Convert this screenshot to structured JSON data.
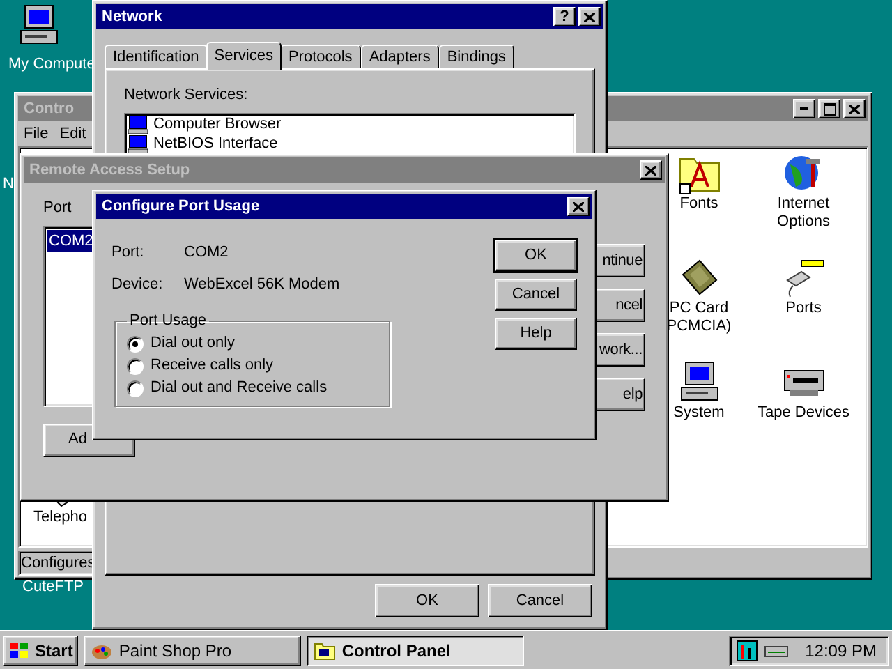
{
  "desktop": {
    "icons": [
      {
        "label": "My Compute"
      },
      {
        "label": "N"
      },
      {
        "label": "CuteFTP"
      }
    ]
  },
  "control_panel": {
    "title": "Contro",
    "active": false,
    "menu": [
      "File",
      "Edit"
    ],
    "items": [
      {
        "lines": [
          "Fonts"
        ]
      },
      {
        "lines": [
          "Internet",
          "Options"
        ]
      },
      {
        "lines": [
          "PC Card",
          "PCMCIA)"
        ]
      },
      {
        "lines": [
          "Ports"
        ]
      },
      {
        "lines": [
          "System"
        ]
      },
      {
        "lines": [
          "Tape Devices"
        ]
      },
      {
        "lines": [
          "Telepho"
        ]
      }
    ],
    "status_bar": "Configures"
  },
  "network": {
    "title": "Network",
    "active": true,
    "help_button": "?",
    "tabs": [
      {
        "label": "Identification",
        "selected": false
      },
      {
        "label": "Services",
        "selected": true
      },
      {
        "label": "Protocols",
        "selected": false
      },
      {
        "label": "Adapters",
        "selected": false
      },
      {
        "label": "Bindings",
        "selected": false
      }
    ],
    "list_label": "Network Services:",
    "services": [
      "Computer Browser",
      "NetBIOS Interface"
    ],
    "buttons": [
      "OK",
      "Cancel"
    ]
  },
  "remote_access": {
    "title": "Remote Access Setup",
    "active": false,
    "port_label": "Port",
    "ports": [
      {
        "label": "COM2",
        "selected": true
      }
    ],
    "side_buttons": [
      "ntinue",
      "ncel",
      "work...",
      "elp"
    ],
    "bottom_buttons": [
      "Ad"
    ]
  },
  "configure_port": {
    "title": "Configure Port Usage",
    "active": true,
    "fields": [
      {
        "label": "Port:",
        "value": "COM2"
      },
      {
        "label": "Device:",
        "value": "WebExcel 56K Modem"
      }
    ],
    "group": "Port Usage",
    "options": [
      {
        "label": "Dial out only",
        "selected": true
      },
      {
        "label": "Receive calls only",
        "selected": false
      },
      {
        "label": "Dial out and Receive calls",
        "selected": false
      }
    ],
    "buttons": [
      {
        "label": "OK",
        "default": true
      },
      {
        "label": "Cancel",
        "default": false
      },
      {
        "label": "Help",
        "default": false
      }
    ]
  },
  "taskbar": {
    "start": "Start",
    "tasks": [
      {
        "label": "Paint Shop Pro",
        "selected": false
      },
      {
        "label": "Control Panel",
        "selected": true
      }
    ],
    "clock": "12:09 PM"
  }
}
